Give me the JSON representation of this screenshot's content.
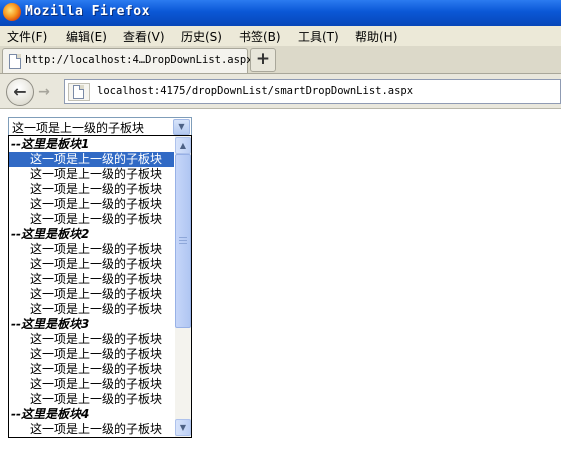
{
  "window": {
    "title": "Mozilla Firefox"
  },
  "menu": [
    {
      "label": "文件(F)"
    },
    {
      "label": "编辑(E)"
    },
    {
      "label": "查看(V)"
    },
    {
      "label": "历史(S)"
    },
    {
      "label": "书签(B)"
    },
    {
      "label": "工具(T)"
    },
    {
      "label": "帮助(H)"
    }
  ],
  "tab": {
    "title": "http://localhost:4…DropDownList.aspx",
    "new_tab_label": "+"
  },
  "nav": {
    "back_glyph": "←",
    "forward_glyph": "→",
    "url": "localhost:4175/dropDownList/smartDropDownList.aspx"
  },
  "select": {
    "value": "这一项是上一级的子板块",
    "arrow_glyph": "▼",
    "options": [
      {
        "label": "--这里是板块1",
        "type": "group"
      },
      {
        "label": "这一项是上一级的子板块",
        "type": "child",
        "selected": true
      },
      {
        "label": "这一项是上一级的子板块",
        "type": "child"
      },
      {
        "label": "这一项是上一级的子板块",
        "type": "child"
      },
      {
        "label": "这一项是上一级的子板块",
        "type": "child"
      },
      {
        "label": "这一项是上一级的子板块",
        "type": "child"
      },
      {
        "label": "--这里是板块2",
        "type": "group"
      },
      {
        "label": "这一项是上一级的子板块",
        "type": "child"
      },
      {
        "label": "这一项是上一级的子板块",
        "type": "child"
      },
      {
        "label": "这一项是上一级的子板块",
        "type": "child"
      },
      {
        "label": "这一项是上一级的子板块",
        "type": "child"
      },
      {
        "label": "这一项是上一级的子板块",
        "type": "child"
      },
      {
        "label": "--这里是板块3",
        "type": "group"
      },
      {
        "label": "这一项是上一级的子板块",
        "type": "child"
      },
      {
        "label": "这一项是上一级的子板块",
        "type": "child"
      },
      {
        "label": "这一项是上一级的子板块",
        "type": "child"
      },
      {
        "label": "这一项是上一级的子板块",
        "type": "child"
      },
      {
        "label": "这一项是上一级的子板块",
        "type": "child"
      },
      {
        "label": "--这里是板块4",
        "type": "group"
      },
      {
        "label": "这一项是上一级的子板块",
        "type": "child"
      }
    ],
    "scroll_up_glyph": "▲",
    "scroll_down_glyph": "▼"
  },
  "colors": {
    "titlebar": "#0a57d6",
    "selection": "#316ac5",
    "scrollbar": "#b4c9f0"
  }
}
